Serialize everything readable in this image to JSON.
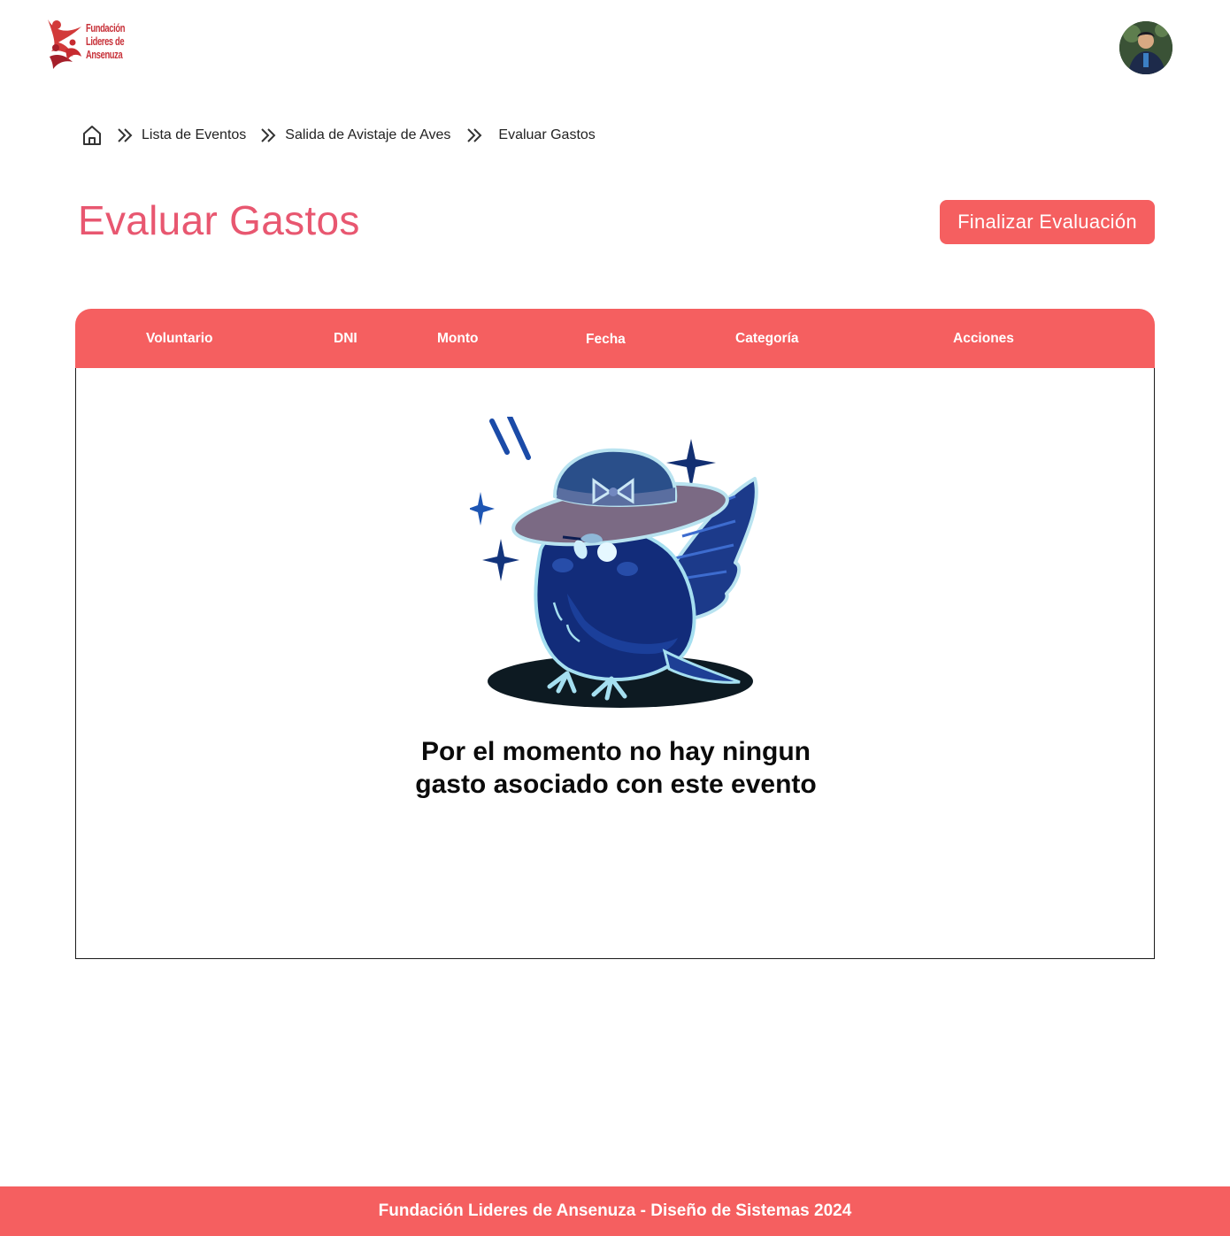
{
  "brand": {
    "logo_lines": [
      "Fundación",
      "Lideres de",
      "Ansenuza"
    ],
    "accent": "#f55f60",
    "title_color": "#e85770",
    "logo_color": "#c8323a"
  },
  "user": {
    "avatar_icon": "user-avatar"
  },
  "breadcrumb": {
    "home_icon": "home-icon",
    "items": [
      "Lista de Eventos",
      "Salida de Avistaje de Aves",
      "Evaluar Gastos"
    ]
  },
  "page": {
    "title": "Evaluar Gastos",
    "finish_button": "Finalizar Evaluación"
  },
  "table": {
    "columns": [
      "Voluntario",
      "DNI",
      "Monto",
      "Fecha",
      "Categoría",
      "Acciones"
    ],
    "rows": [],
    "empty_message": "Por el momento no hay ningun gasto asociado con este evento",
    "empty_illustration": "bird-with-hat-illustration"
  },
  "footer": {
    "text": "Fundación Lideres de Ansenuza - Diseño de Sistemas 2024"
  }
}
